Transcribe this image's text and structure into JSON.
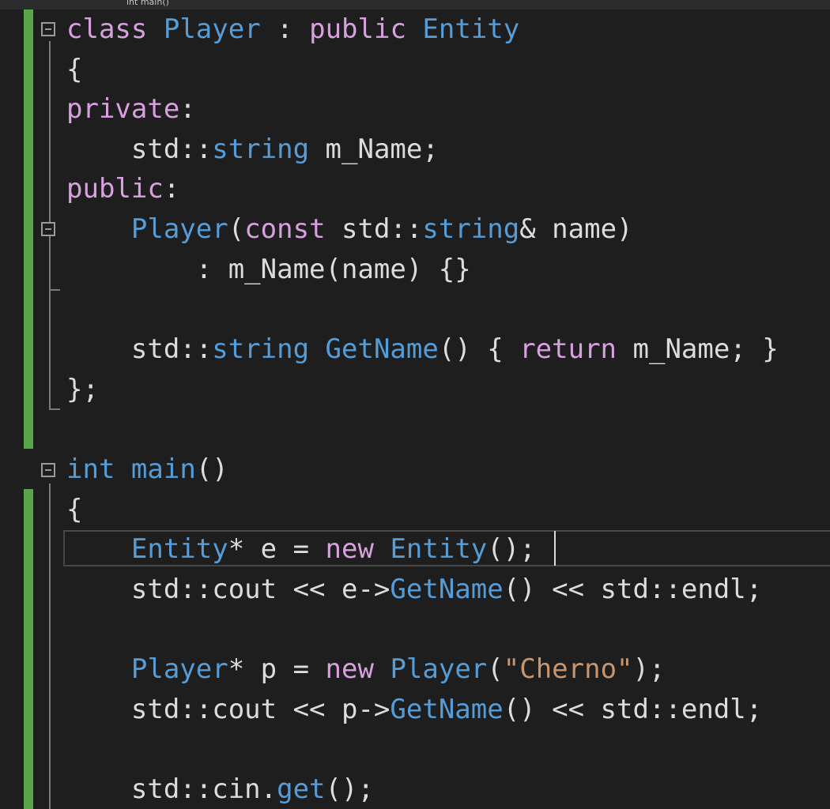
{
  "tab": {
    "label": "int main()"
  },
  "colors": {
    "background": "#1e1e1e",
    "text": "#dcdcdc",
    "keyword": "#d8a0df",
    "type": "#569cd6",
    "string": "#c8956c",
    "changed_margin": "#57a64a"
  },
  "code": {
    "lines": [
      [
        "class",
        " ",
        "Player",
        " : ",
        "public",
        " ",
        "Entity"
      ],
      [
        "{"
      ],
      [
        "private",
        ":"
      ],
      [
        "    std::",
        "string",
        " m_Name;"
      ],
      [
        "public",
        ":"
      ],
      [
        "    ",
        "Player",
        "(",
        "const",
        " std::",
        "string",
        "& name)"
      ],
      [
        "        : m_Name(name) {}"
      ],
      [
        ""
      ],
      [
        "    std::",
        "string",
        " ",
        "GetName",
        "() { ",
        "return",
        " m_Name; }"
      ],
      [
        "};"
      ],
      [
        ""
      ],
      [
        "int",
        " ",
        "main",
        "()"
      ],
      [
        "{"
      ],
      [
        "    ",
        "Entity",
        "* e = ",
        "new",
        " ",
        "Entity",
        "();"
      ],
      [
        "    std::cout << e->",
        "GetName",
        "() << std::endl;"
      ],
      [
        ""
      ],
      [
        "    ",
        "Player",
        "* p = ",
        "new",
        " ",
        "Player",
        "(",
        "\"Cherno\"",
        ");"
      ],
      [
        "    std::cout << p->",
        "GetName",
        "() << std::endl;"
      ],
      [
        ""
      ],
      [
        "    std::cin.",
        "get",
        "();"
      ]
    ]
  }
}
